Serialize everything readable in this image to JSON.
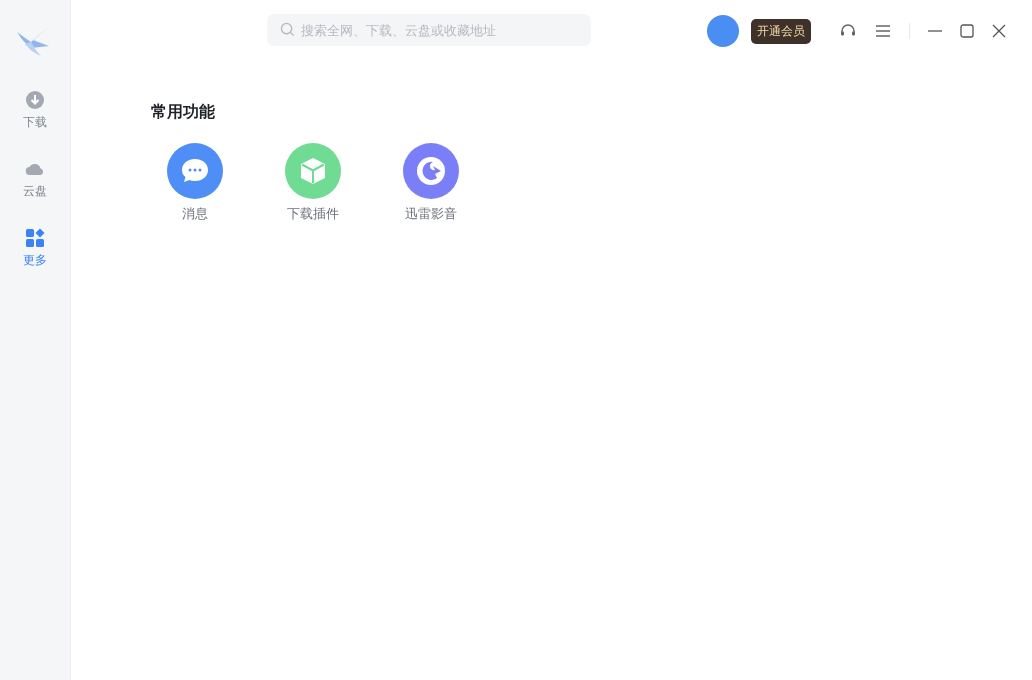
{
  "sidebar": {
    "items": [
      {
        "kind": "download",
        "label": "下载",
        "selected": false
      },
      {
        "kind": "cloud",
        "label": "云盘",
        "selected": false
      },
      {
        "kind": "more",
        "label": "更多",
        "selected": true
      }
    ]
  },
  "search": {
    "placeholder": "搜索全网、下载、云盘或收藏地址"
  },
  "vip_button": "开通会员",
  "section": {
    "title": "常用功能",
    "items": [
      {
        "kind": "message",
        "label": "消息"
      },
      {
        "kind": "plugin",
        "label": "下载插件"
      },
      {
        "kind": "player",
        "label": "迅雷影音"
      }
    ]
  }
}
